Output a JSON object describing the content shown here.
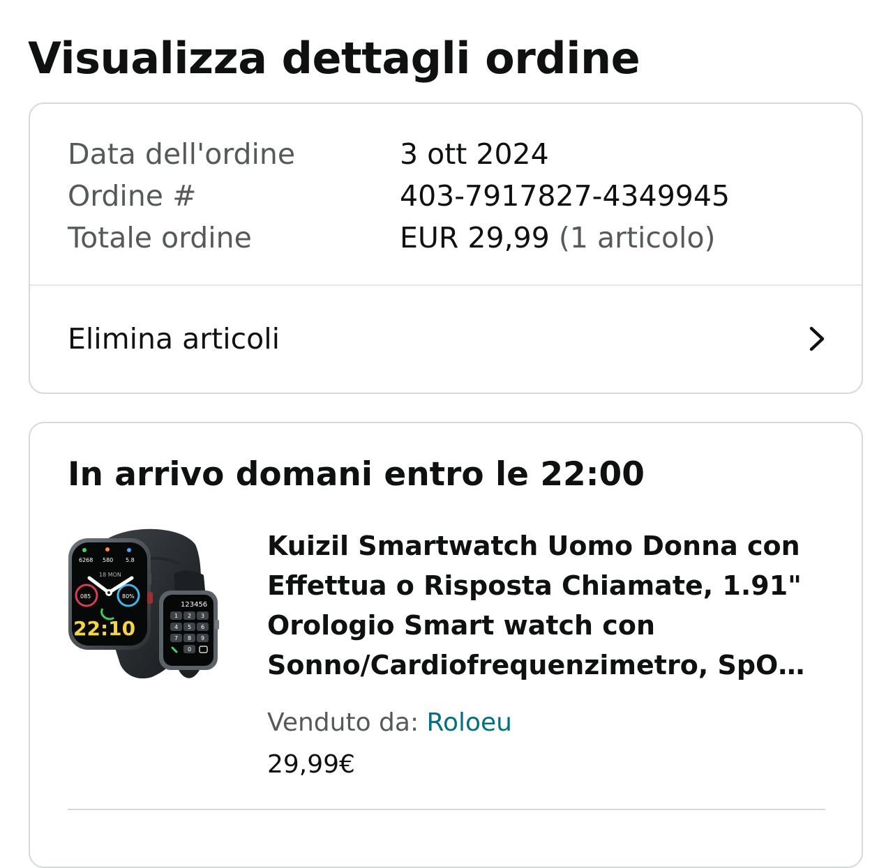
{
  "page": {
    "title": "Visualizza dettagli ordine"
  },
  "summary": {
    "order_date_label": "Data dell'ordine",
    "order_date_value": "3 ott 2024",
    "order_number_label": "Ordine #",
    "order_number_value": "403-7917827-4349945",
    "order_total_label": "Totale ordine",
    "order_total_value": "EUR 29,99",
    "order_total_items": "(1 articolo)"
  },
  "actions": {
    "delete_items_label": "Elimina articoli",
    "delete_items_icon": "chevron-right-icon"
  },
  "shipment": {
    "delivery_title": "In arrivo domani entro le 22:00",
    "product": {
      "image_icon": "smartwatch-product-image",
      "title": "Kuizil Smartwatch Uomo Donna con Effettua o Risposta Chiamate, 1.91\" Orologio Smart watch con Sonno/Cardiofrequenzimetro, SpO…",
      "seller_prefix": "Venduto da:",
      "seller_name": "Roloeu",
      "price": "29,99€"
    },
    "watch_display": {
      "big_time": "22:10",
      "big_date": "18 MON",
      "big_steps": "6268",
      "big_kcal": "580",
      "big_distance": "5.8",
      "big_bpm": "085",
      "big_spo2": "80%",
      "small_number": "123456",
      "keypad": [
        "1",
        "2",
        "3",
        "4",
        "5",
        "6",
        "7",
        "8",
        "9",
        "0"
      ]
    }
  },
  "colors": {
    "text_primary": "#0f1111",
    "text_secondary": "#565959",
    "link": "#007185",
    "border": "#d5d9d9",
    "background": "#ffffff",
    "watch_time": "#f5d547"
  }
}
